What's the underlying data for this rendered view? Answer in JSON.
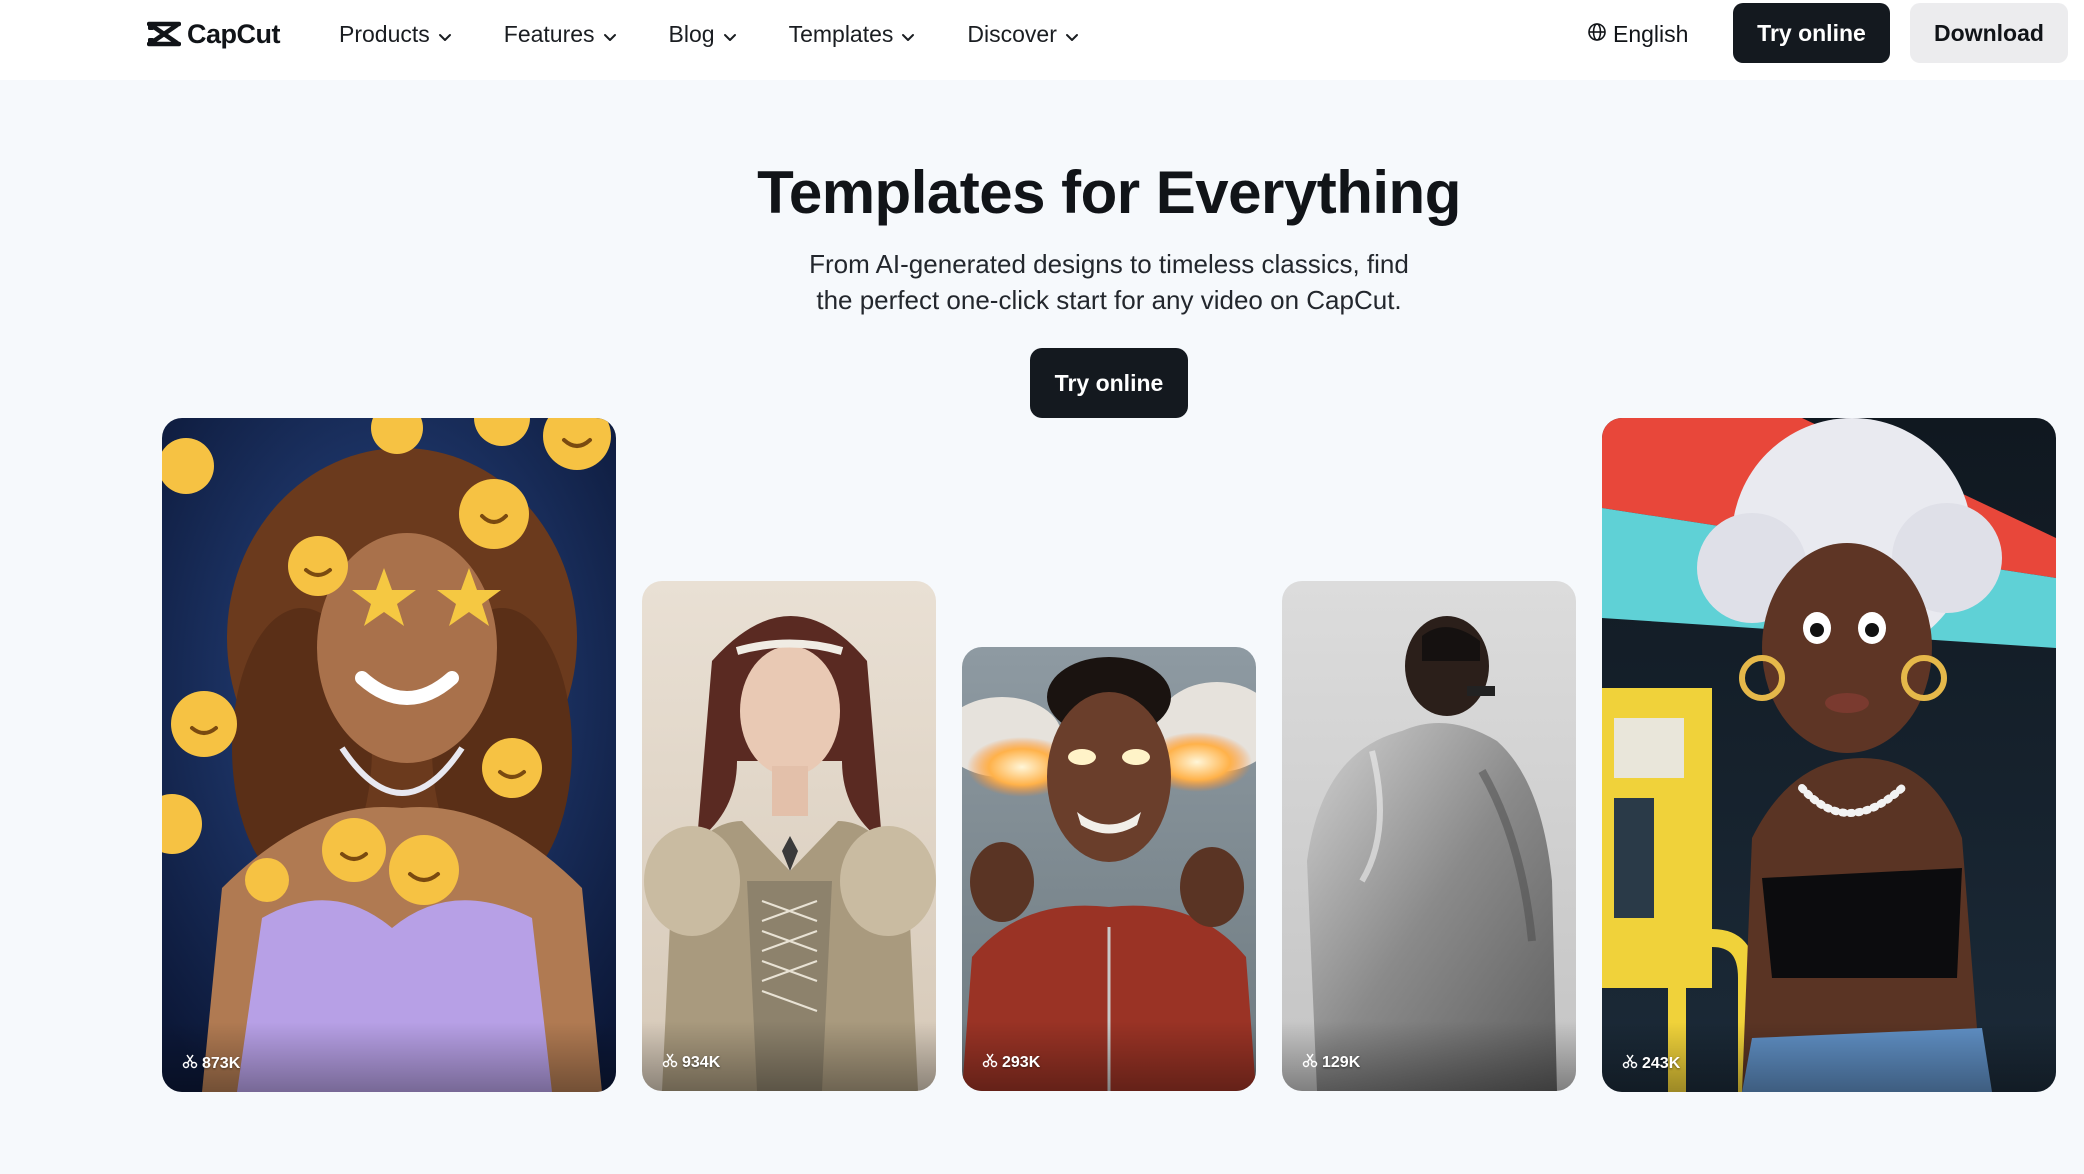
{
  "nav": {
    "logo_text": "CapCut",
    "items": [
      {
        "label": "Products"
      },
      {
        "label": "Features"
      },
      {
        "label": "Blog"
      },
      {
        "label": "Templates"
      },
      {
        "label": "Discover"
      }
    ],
    "language": "English",
    "try_online": "Try online",
    "download": "Download"
  },
  "hero": {
    "title": "Templates for Everything",
    "subtitle_line1": "From AI-generated designs to timeless classics, find",
    "subtitle_line2": "the perfect one-click start for any video on CapCut.",
    "cta": "Try online"
  },
  "templates": [
    {
      "usage": "873K",
      "subject": "woman with emoji stickers"
    },
    {
      "usage": "934K",
      "subject": "woman in renaissance dress"
    },
    {
      "usage": "293K",
      "subject": "man with fire eyes"
    },
    {
      "usage": "129K",
      "subject": "man in grey hoodie"
    },
    {
      "usage": "243K",
      "subject": "cartoon woman at gas station"
    }
  ],
  "icons": {
    "logo": "capcut-logo-icon",
    "chevron": "chevron-down-icon",
    "globe": "globe-icon",
    "uses": "scissors-icon"
  },
  "colors": {
    "primary_button": "#14191f",
    "secondary_button": "#ececee",
    "page_background": "#f6f9fc"
  }
}
